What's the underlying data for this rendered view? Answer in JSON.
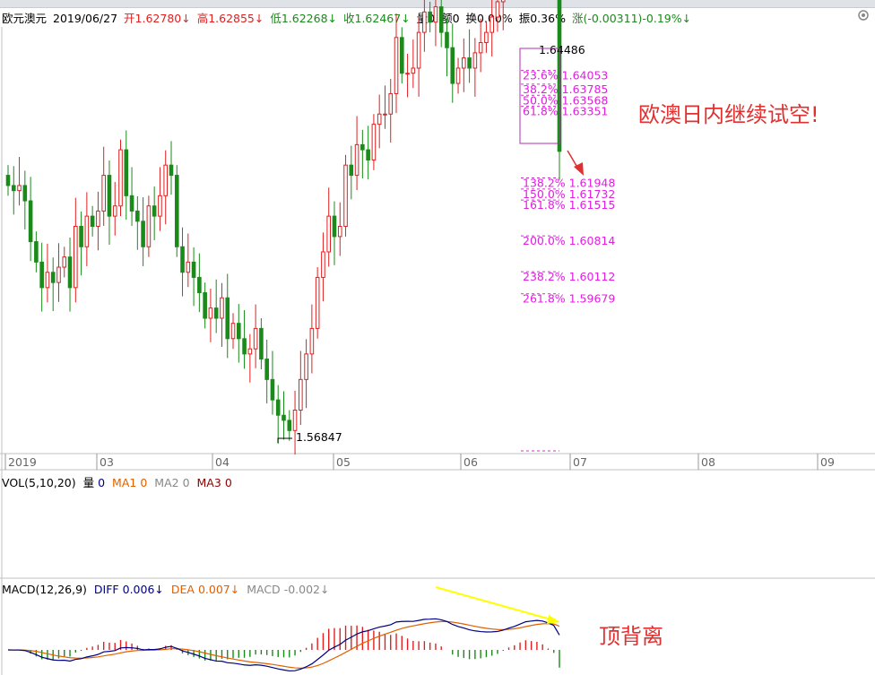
{
  "header": {
    "symbol": "欧元澳元",
    "date": "2019/06/27",
    "open": "开1.62780↓",
    "high": "高1.62855↓",
    "low": "低1.62268↓",
    "close": "收1.62467↓",
    "volume": "量0",
    "amount": "额0",
    "turnover": "换0.00%",
    "amplitude": "振0.36%",
    "change": "涨(-0.00311)-0.19%↓"
  },
  "colors": {
    "up": "#e02020",
    "down": "#1a8a1a",
    "fib": "#e020e0",
    "diff": "#000080",
    "dea": "#e06000",
    "annotation": "#e03030",
    "arrow": "#ffff00"
  },
  "chart_data": {
    "type": "candlestick",
    "x_ticks": [
      "2019",
      "03",
      "04",
      "05",
      "06",
      "07",
      "08",
      "09"
    ],
    "high_label": "1.64486",
    "low_label": "1.56847",
    "fib_levels": [
      {
        "label": "23.6%",
        "value": "1.64053"
      },
      {
        "label": "38.2%",
        "value": "1.63785"
      },
      {
        "label": "50.0%",
        "value": "1.63568"
      },
      {
        "label": "61.8%",
        "value": "1.63351"
      },
      {
        "label": "138.2%",
        "value": "1.61948"
      },
      {
        "label": "150.0%",
        "value": "1.61732"
      },
      {
        "label": "161.8%",
        "value": "1.61515"
      },
      {
        "label": "200.0%",
        "value": "1.60814"
      },
      {
        "label": "238.2%",
        "value": "1.60112"
      },
      {
        "label": "261.8%",
        "value": "1.59679"
      }
    ],
    "annotation_main": "欧澳日内继续试空!",
    "annotation_macd": "顶背离",
    "closes": [
      1.618,
      1.617,
      1.618,
      1.615,
      1.607,
      1.603,
      1.598,
      1.601,
      1.599,
      1.602,
      1.604,
      1.598,
      1.61,
      1.606,
      1.612,
      1.61,
      1.613,
      1.62,
      1.612,
      1.614,
      1.625,
      1.616,
      1.613,
      1.611,
      1.606,
      1.614,
      1.612,
      1.616,
      1.622,
      1.62,
      1.606,
      1.601,
      1.603,
      1.6,
      1.597,
      1.592,
      1.594,
      1.592,
      1.596,
      1.588,
      1.591,
      1.588,
      1.585,
      1.586,
      1.59,
      1.584,
      1.58,
      1.576,
      1.573,
      1.572,
      1.57,
      1.574,
      1.58,
      1.585,
      1.59,
      1.6,
      1.605,
      1.612,
      1.608,
      1.61,
      1.622,
      1.62,
      1.626,
      1.625,
      1.623,
      1.63,
      1.632,
      1.632,
      1.636,
      1.647,
      1.64,
      1.64,
      1.641,
      1.648,
      1.652,
      1.65,
      1.653,
      1.648,
      1.645,
      1.638,
      1.641,
      1.643,
      1.641,
      1.644,
      1.646,
      1.648,
      1.651,
      1.654,
      1.661,
      1.667,
      1.669,
      1.676,
      1.68,
      1.676,
      1.678,
      1.674,
      1.668,
      1.664,
      1.6247
    ],
    "volume_legend": {
      "label": "VOL(5,10,20)",
      "vol": "量",
      "vol_v": "0",
      "ma1": "MA1",
      "ma1_v": "0",
      "ma2": "MA2",
      "ma2_v": "0",
      "ma3": "MA3",
      "ma3_v": "0"
    },
    "macd_legend": {
      "label": "MACD(12,26,9)",
      "diff": "DIFF",
      "diff_v": "0.006↓",
      "dea": "DEA",
      "dea_v": "0.007↓",
      "macd": "MACD",
      "macd_v": "-0.002↓"
    }
  }
}
